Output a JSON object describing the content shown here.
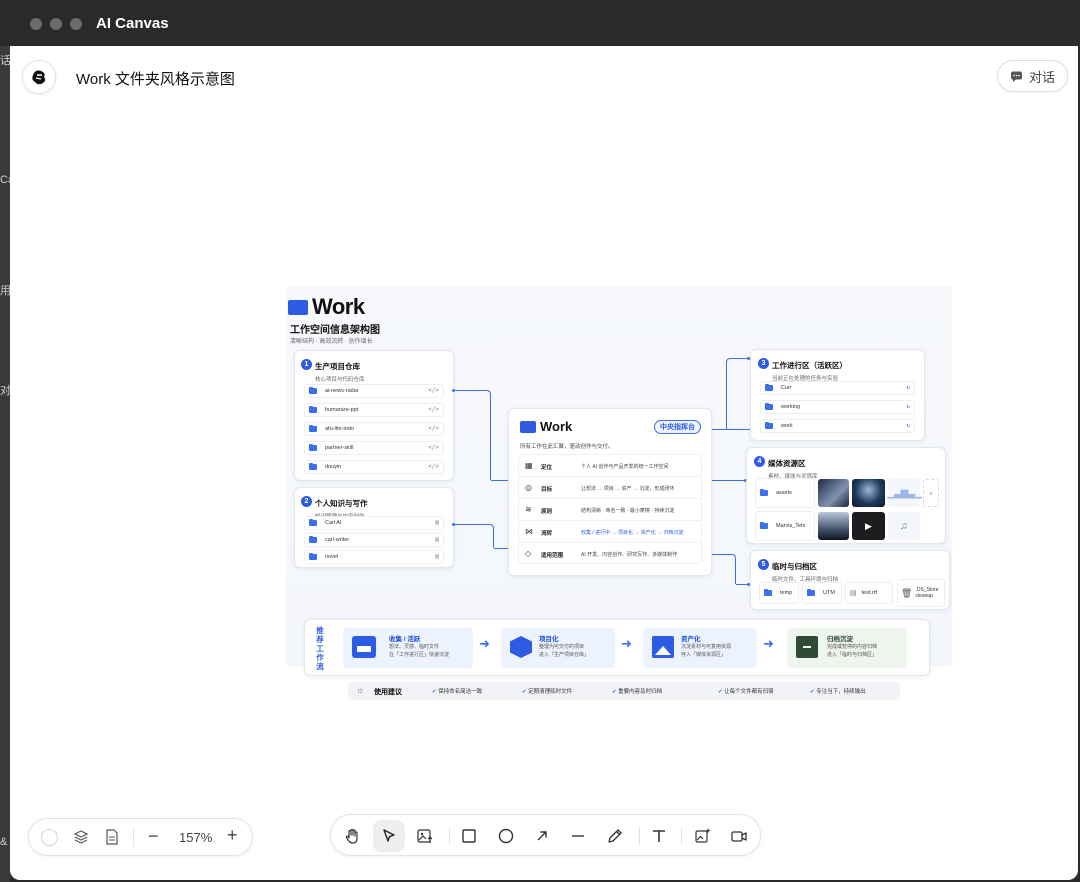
{
  "window": {
    "title": "AI Canvas"
  },
  "header": {
    "doc_title": "Work 文件夹风格示意图",
    "chat_label": "对话"
  },
  "edge_glyphs": [
    "话",
    "Ca",
    "用",
    "对话",
    "&"
  ],
  "diagram": {
    "brand": "Work",
    "subtitle": "工作空间信息架构图",
    "tagline": "清晰结构 · 高效流转 · 创作增长",
    "sections": [
      {
        "num": "1",
        "title": "生产项目仓库",
        "sub": "核心项目与代码仓库",
        "items": [
          "ai-news-radar",
          "humanize-ppt",
          "afu-llm-todo",
          "partner-skill",
          "douyin"
        ]
      },
      {
        "num": "2",
        "title": "个人知识与写作",
        "sub": "知识管理与内容创作",
        "items": [
          "Carl AI",
          "carl-writer",
          "novel"
        ]
      },
      {
        "num": "3",
        "title": "工作进行区（活跃区）",
        "sub": "当前正在处理的任务与实验",
        "items": [
          "Curr",
          "working",
          "work"
        ]
      },
      {
        "num": "4",
        "title": "媒体资源区",
        "sub": "素材、媒体与灵感库",
        "items": [
          "assets",
          "Marvis_Tets"
        ]
      },
      {
        "num": "5",
        "title": "临时与归档区",
        "sub": "临时文件、工具环境与归档",
        "items": [
          "temp",
          "UTM",
          "test.rtf",
          ".DS_Store cleanup"
        ]
      }
    ],
    "center": {
      "title": "Work",
      "badge": "中央指挥台",
      "desc": "所有工作在此汇聚，驱动创作与交付。",
      "rows": [
        {
          "label": "定位",
          "desc": "个人 AI 创作与产品开发的统一工作空间"
        },
        {
          "label": "目标",
          "desc": "让想法 → 项目 → 资产 → 沉淀，形成闭环"
        },
        {
          "label": "原则",
          "desc": "结构清晰 · 命名一致 · 最小摩擦 · 持续沉淀"
        },
        {
          "label": "流转",
          "desc": "收集 / 进行中 → 项目化 → 资产化 → 归档沉淀"
        },
        {
          "label": "适用范围",
          "desc": "AI 开发、内容创作、研究写作、多媒体制作"
        }
      ]
    },
    "workflow": {
      "label": "推荐工作流",
      "steps": [
        {
          "title": "收集 / 活跃",
          "desc1": "想法、灵感、临时文件",
          "desc2": "在「工作进行区」快速沉淀"
        },
        {
          "title": "项目化",
          "desc1": "整理为可交付的项目",
          "desc2": "进入「生产项目仓库」"
        },
        {
          "title": "资产化",
          "desc1": "沉淀素材与可复用资源",
          "desc2": "存入「媒体资源区」"
        },
        {
          "title": "归档沉淀",
          "desc1": "完成或暂停的内容归档",
          "desc2": "进入「临时与归档区」"
        }
      ]
    },
    "tips": {
      "label": "使用建议",
      "items": [
        "保持命名简洁一致",
        "定期清理临时文件",
        "重要内容及时归档",
        "让每个文件都有归宿",
        "专注当下，持续输出"
      ]
    }
  },
  "zoom": {
    "level": "157%"
  }
}
